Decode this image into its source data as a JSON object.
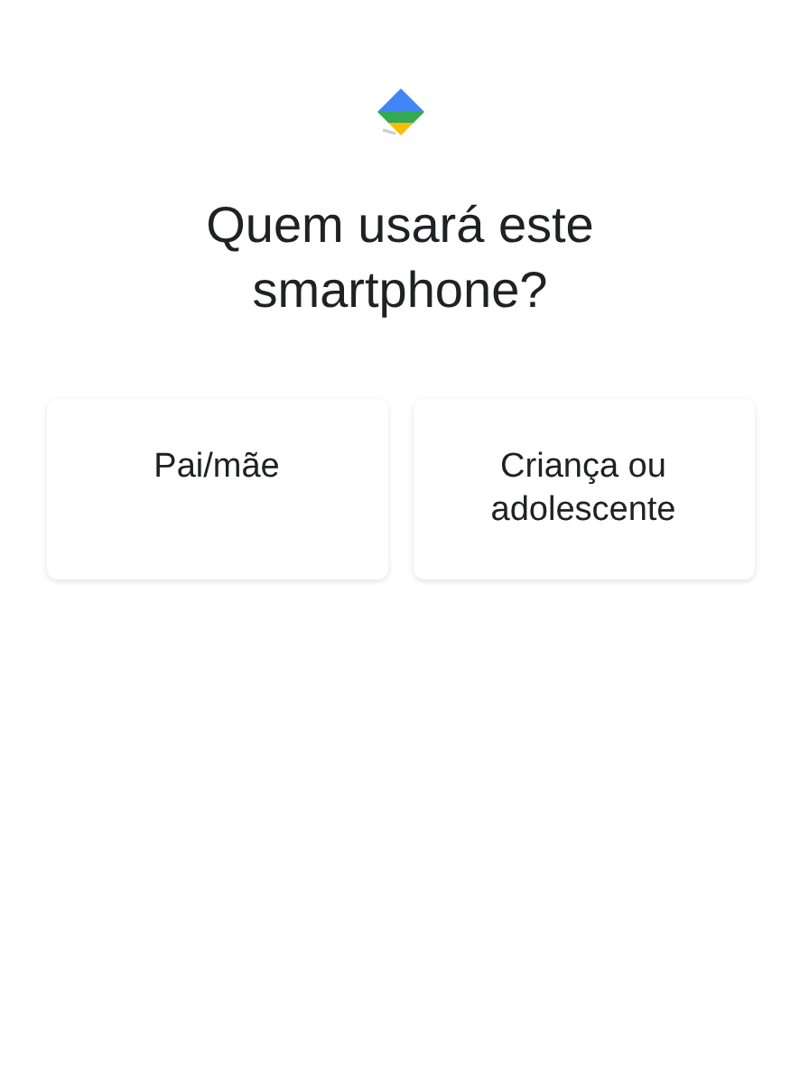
{
  "title": "Quem usará este smartphone?",
  "options": [
    {
      "label": "Pai/mãe"
    },
    {
      "label": "Criança ou adolescente"
    }
  ]
}
